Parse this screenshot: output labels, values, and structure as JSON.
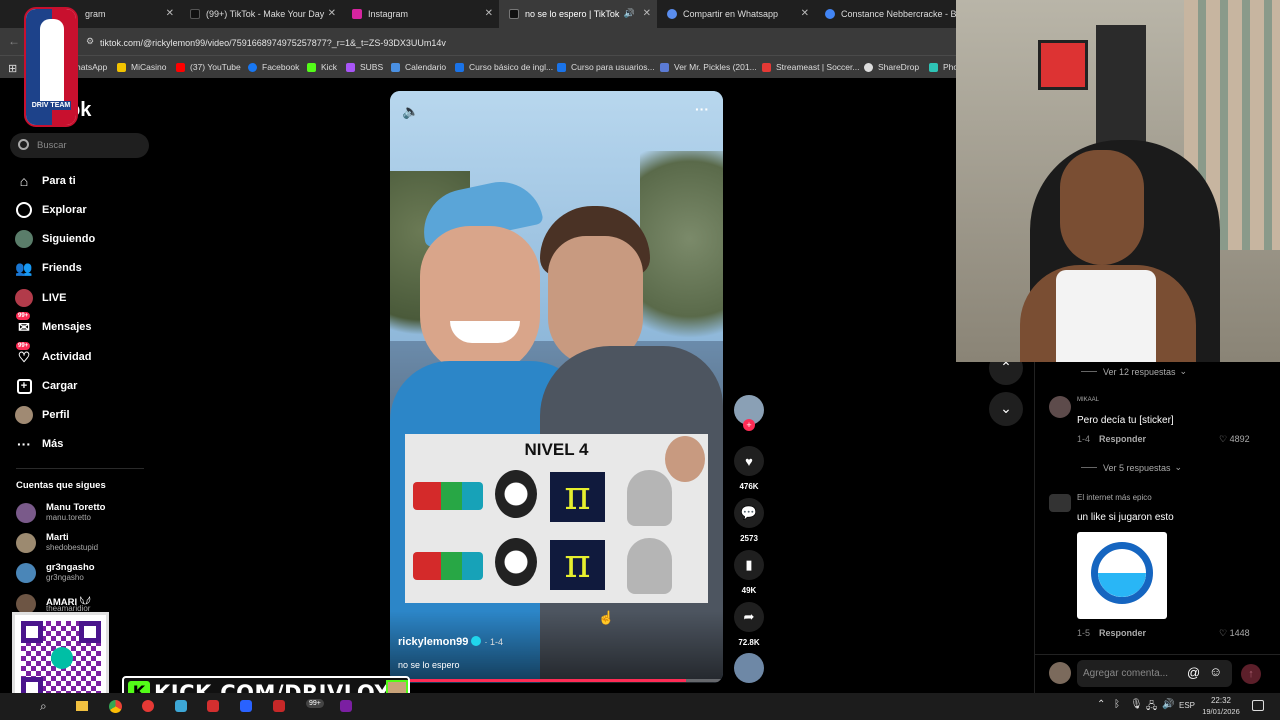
{
  "tabs": [
    {
      "label": "gram",
      "active": false
    },
    {
      "label": "(99+) TikTok - Make Your Day",
      "active": false
    },
    {
      "label": "Instagram",
      "active": false
    },
    {
      "label": "no se lo espero | TikTok",
      "active": true
    },
    {
      "label": "Compartir en Whatsapp",
      "active": false
    },
    {
      "label": "Constance Nebbercracke - Bus",
      "active": false
    }
  ],
  "address": {
    "url": "tiktok.com/@rickylemon99/video/7591668974975257877?_r=1&_t=ZS-93DX3UUm14v"
  },
  "bookmarks": [
    "hatsApp",
    "MiCasino",
    "(37) YouTube",
    "Facebook",
    "Kick",
    "SUBS",
    "Calendario",
    "Curso básico de ingl...",
    "Curso para usuarios...",
    "Ver Mr. Pickles (201...",
    "Streameast | Soccer...",
    "ShareDrop",
    "Pho"
  ],
  "sidebar": {
    "logo": "ok",
    "search_placeholder": "Buscar",
    "nav": [
      {
        "label": "Para ti",
        "icon": "home-icon"
      },
      {
        "label": "Explorar",
        "icon": "compass-icon"
      },
      {
        "label": "Siguiendo",
        "icon": "following-icon"
      },
      {
        "label": "Friends",
        "icon": "friends-icon"
      },
      {
        "label": "LIVE",
        "icon": "live-icon"
      },
      {
        "label": "Mensajes",
        "icon": "messages-icon",
        "badge": "99+"
      },
      {
        "label": "Actividad",
        "icon": "activity-icon",
        "badge": "99+"
      },
      {
        "label": "Cargar",
        "icon": "upload-icon"
      },
      {
        "label": "Perfil",
        "icon": "profile-icon"
      },
      {
        "label": "Más",
        "icon": "more-icon"
      }
    ],
    "following_title": "Cuentas que sigues",
    "accounts": [
      {
        "name": "Manu Toretto",
        "handle": "manu.toretto"
      },
      {
        "name": "Marti",
        "handle": "shedobestupid"
      },
      {
        "name": "gr3ngasho",
        "handle": "gr3ngasho"
      },
      {
        "name": "AMARI 𓆩𓆪",
        "handle": "theamaridior"
      }
    ]
  },
  "video": {
    "nivel_title": "NIVEL 4",
    "author": "rickylemon99",
    "date": "· 1-4",
    "caption": "no se lo espero",
    "progress": 0.89
  },
  "actions": {
    "likes": "476K",
    "comments": "2573",
    "saves": "49K",
    "shares": "72.8K"
  },
  "comments": {
    "view_replies_1": "Ver 12 respuestas",
    "c1_author": "MIKAAL",
    "c1_text": "Pero decía tu [sticker]",
    "c1_date": "1-4",
    "c1_likes": "4892",
    "view_replies_2": "Ver 5 respuestas",
    "c2_author": "El internet más epico",
    "c2_text": "un like si jugaron esto",
    "c2_date": "1-5",
    "c2_likes": "1448",
    "reply_label": "Responder",
    "input_placeholder": "Agregar comenta..."
  },
  "overlay": {
    "kick_text": "KICK.COM/DRIVLOY",
    "drivteam_text": "DRIV TEAM"
  },
  "taskbar": {
    "time": "22:32",
    "date": "19/01/2026",
    "lang": "ESP",
    "badge": "99+"
  }
}
